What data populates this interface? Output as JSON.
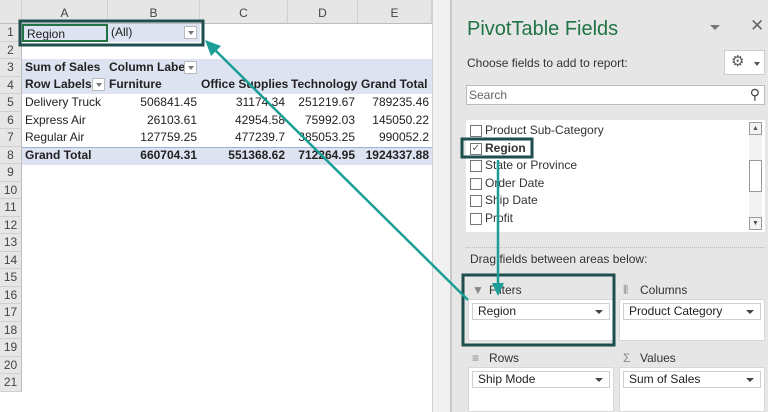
{
  "sheet": {
    "columns": [
      "A",
      "B",
      "C",
      "D",
      "E"
    ],
    "rows": [
      "1",
      "2",
      "3",
      "4",
      "5",
      "6",
      "7",
      "8",
      "9",
      "10",
      "11",
      "12",
      "13",
      "14",
      "15",
      "16",
      "17",
      "18",
      "19",
      "20",
      "21"
    ],
    "filter": {
      "field": "Region",
      "value": "(All)"
    },
    "pivot": {
      "corner": "Sum of Sales",
      "column_labels": "Column Label",
      "row_labels": "Row Labels",
      "headers": [
        "Furniture",
        "Office Supplies",
        "Technology",
        "Grand Total"
      ],
      "data": [
        {
          "label": "Delivery Truck",
          "values": [
            "506841.45",
            "31174.34",
            "251219.67",
            "789235.46"
          ]
        },
        {
          "label": "Express Air",
          "values": [
            "26103.61",
            "42954.58",
            "75992.03",
            "145050.22"
          ]
        },
        {
          "label": "Regular Air",
          "values": [
            "127759.25",
            "477239.7",
            "385053.25",
            "990052.2"
          ]
        }
      ],
      "total": {
        "label": "Grand Total",
        "values": [
          "660704.31",
          "551368.62",
          "712264.95",
          "1924337.88"
        ]
      }
    }
  },
  "panel": {
    "title": "PivotTable Fields",
    "subtitle": "Choose fields to add to report:",
    "search_placeholder": "Search",
    "fields": [
      {
        "label": "Product Sub-Category",
        "checked": false
      },
      {
        "label": "Region",
        "checked": true
      },
      {
        "label": "State or Province",
        "checked": false
      },
      {
        "label": "Order Date",
        "checked": false
      },
      {
        "label": "Ship Date",
        "checked": false
      },
      {
        "label": "Profit",
        "checked": false
      }
    ],
    "drag_hint": "Drag fields between areas below:",
    "areas": {
      "filters": {
        "title": "Filters",
        "item": "Region"
      },
      "columns": {
        "title": "Columns",
        "item": "Product Category"
      },
      "rows": {
        "title": "Rows",
        "item": "Ship Mode"
      },
      "values": {
        "title": "Values",
        "item": "Sum of Sales"
      }
    }
  },
  "colors": {
    "accent": "#1a9e96",
    "highlight_box": "#1f4e4e",
    "title_green": "#217346",
    "pivot_band": "#dde3f1"
  }
}
